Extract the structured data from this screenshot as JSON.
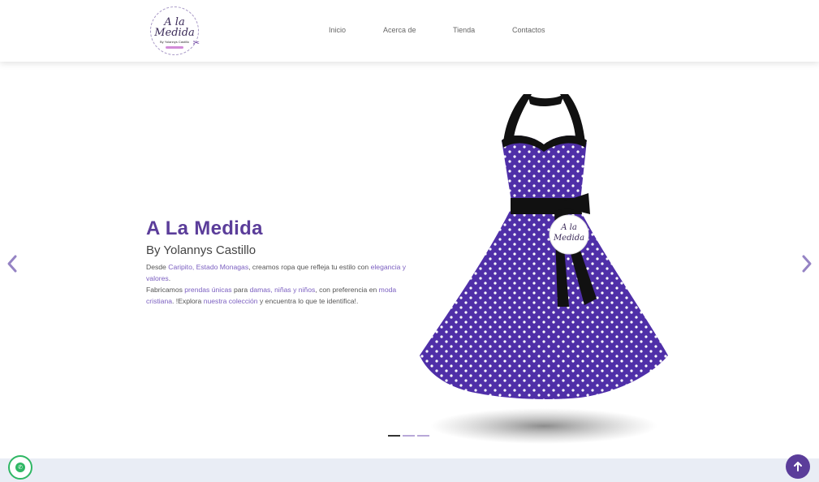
{
  "brand": {
    "logo_line1": "A la",
    "logo_line2": "Medida",
    "logo_line3": "By Yolannys Castillo"
  },
  "nav": {
    "items": [
      {
        "label": "Inicio"
      },
      {
        "label": "Acerca de"
      },
      {
        "label": "Tienda"
      },
      {
        "label": "Contactos"
      }
    ]
  },
  "hero": {
    "title": "A La Medida",
    "subtitle": "By Yolannys Castillo",
    "desc": {
      "p1_a": "Desde ",
      "p1_hl1": "Caripito, Estado Monagas",
      "p1_b": ", creamos ropa que refleja tu estilo con ",
      "p1_hl2": "elegancia y valores",
      "p1_c": ".",
      "p2_a": "Fabricamos ",
      "p2_hl1": "prendas únicas",
      "p2_b": " para ",
      "p2_hl2": "damas, niñas y niños",
      "p2_c": ", con preferencia en ",
      "p2_hl3": "moda cristiana",
      "p2_d": ". !Explora ",
      "p2_hl4": "nuestra colección",
      "p2_e": " y encuentra lo que te identifica!."
    },
    "tag_line1": "A la",
    "tag_line2": "Medida",
    "slides_count": 3,
    "active_slide": 1
  },
  "colors": {
    "brand_purple": "#5b3d9a",
    "highlight": "#7b5fc0",
    "whatsapp_green": "#2fb764",
    "dress_purple": "#4f2fa8"
  },
  "icons": {
    "prev": "chevron-left-icon",
    "next": "chevron-right-icon",
    "whatsapp": "whatsapp-icon",
    "back_to_top": "arrow-up-icon"
  }
}
